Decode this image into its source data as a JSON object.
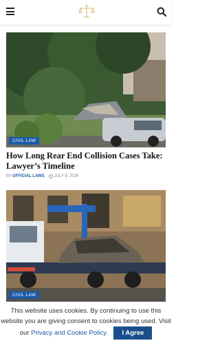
{
  "header": {
    "menu_icon": "hamburger-menu-icon",
    "logo_icon": "scales-of-justice-logo",
    "search_icon": "search-icon"
  },
  "articles": [
    {
      "category": "CIVIL LAW",
      "title": "How Long Rear End Collision Cases Take: Lawyer’s Timeline",
      "by": "BY",
      "author": "OFFICIAL LAWS",
      "date": "JULY 9, 2026",
      "image": "crashed-car-with-open-hood-under-tree"
    },
    {
      "category": "CIVIL LAW",
      "image": "tow-truck-carrying-burned-car"
    }
  ],
  "cookie_notice": {
    "text": "This website uses cookies. By continuing to use this website you are giving consent to cookies being used. Visit our",
    "link": "Privacy and Cookie Policy.",
    "button": "I Agree"
  },
  "colors": {
    "accent": "#1a5aa8",
    "button": "#1a4f8c"
  }
}
